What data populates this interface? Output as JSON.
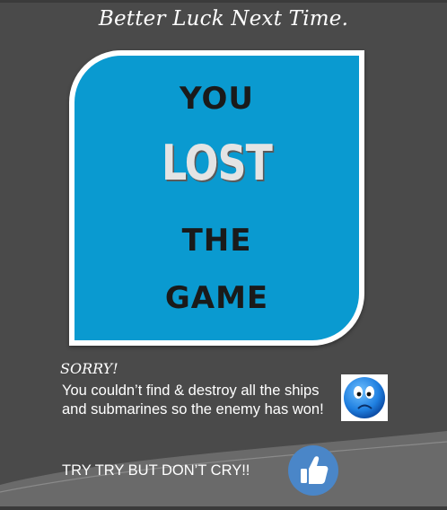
{
  "header": {
    "title": "Better Luck Next Time."
  },
  "card": {
    "line1": "YOU",
    "line2": "LOST",
    "line3": "THE",
    "line4": "GAME"
  },
  "message": {
    "sorry": "SORRY!",
    "body": "You couldn’t find & destroy all the ships and submarines so the enemy has won!",
    "try_again": "TRY TRY BUT DON’T CRY!!"
  },
  "icons": {
    "sad_face": "sad-face-icon",
    "thumbs_up": "thumbs-up-icon"
  },
  "colors": {
    "background": "#4a4a4a",
    "card_blue": "#0a9ad0",
    "thumb_blue": "#4a86c8"
  }
}
